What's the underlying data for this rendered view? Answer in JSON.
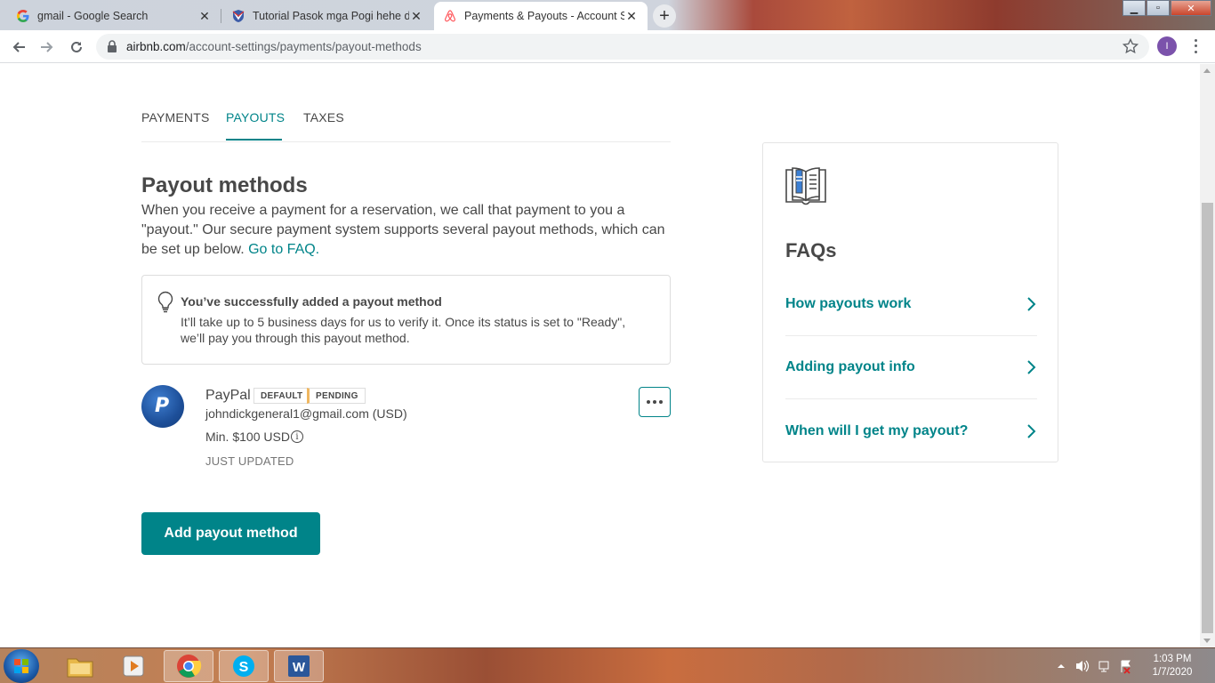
{
  "browser": {
    "tabs": [
      {
        "title": "gmail - Google Search",
        "favicon": "google-g-icon",
        "active": false
      },
      {
        "title": "Tutorial Pasok mga Pogi hehe dit",
        "favicon": "shield-icon",
        "active": false
      },
      {
        "title": "Payments & Payouts - Account S",
        "favicon": "airbnb-icon",
        "active": true
      }
    ],
    "url_domain": "airbnb.com",
    "url_path": "/account-settings/payments/payout-methods",
    "profile_initial": "I"
  },
  "subnav": {
    "tabs": [
      {
        "label": "PAYMENTS",
        "active": false
      },
      {
        "label": "PAYOUTS",
        "active": true
      },
      {
        "label": "TAXES",
        "active": false
      }
    ]
  },
  "page": {
    "title": "Payout methods",
    "intro": "When you receive a payment for a reservation, we call that payment to you a \"payout.\" Our secure payment system supports several payout methods, which can be set up below.",
    "faq_link": "Go to FAQ."
  },
  "notice": {
    "title": "You’ve successfully added a payout method",
    "body": "It’ll take up to 5 business days for us to verify it. Once its status is set to \"Ready\", we’ll pay you through this payout method."
  },
  "payout_method": {
    "name": "PayPal",
    "badge_default": "DEFAULT",
    "badge_pending": "PENDING",
    "email": "johndickgeneral1@gmail.com (USD)",
    "minimum": "Min. $100 USD",
    "status": "JUST UPDATED"
  },
  "add_button": "Add payout method",
  "faq": {
    "heading": "FAQs",
    "items": [
      "How payouts work",
      "Adding payout info",
      "When will I get my payout?"
    ]
  },
  "taskbar": {
    "time": "1:03 PM",
    "date": "1/7/2020"
  },
  "colors": {
    "accent": "#008489",
    "text": "#484848",
    "pending": "#f0b760"
  }
}
